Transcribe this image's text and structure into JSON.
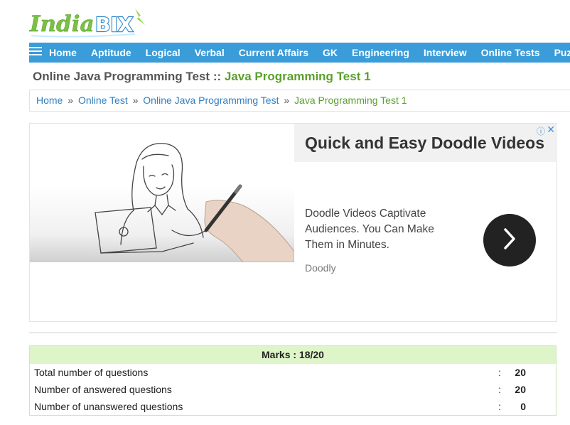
{
  "logo": {
    "text_part1": "India",
    "text_part2": "BIX"
  },
  "nav": {
    "menu_icon": "hamburger-icon",
    "items": [
      "Home",
      "Aptitude",
      "Logical",
      "Verbal",
      "Current Affairs",
      "GK",
      "Engineering",
      "Interview",
      "Online Tests",
      "Puzzles"
    ]
  },
  "page_title": {
    "prefix": "Online Java Programming Test",
    "separator": " :: ",
    "current": "Java Programming Test 1"
  },
  "breadcrumb": {
    "items": [
      "Home",
      "Online Test",
      "Online Java Programming Test"
    ],
    "separator": "»",
    "current": "Java Programming Test 1"
  },
  "ad": {
    "headline": "Quick and Easy Doodle Videos",
    "body": "Doodle Videos Captivate Audiences. You Can Make Them in Minutes.",
    "brand": "Doodly",
    "info_icon": "info-icon",
    "close_icon": "close-icon",
    "cta_icon": "chevron-right-icon"
  },
  "results": {
    "header": "Marks : 18/20",
    "rows": [
      {
        "label": "Total number of questions",
        "colon": ":",
        "value": "20"
      },
      {
        "label": "Number of answered questions",
        "colon": ":",
        "value": "20"
      },
      {
        "label": "Number of unanswered questions",
        "colon": ":",
        "value": "0"
      }
    ]
  },
  "colors": {
    "nav_bg": "#3a9cd8",
    "title_green": "#5aa02c",
    "link_blue": "#2f7fc1",
    "results_header_bg": "#ddf5c8"
  }
}
